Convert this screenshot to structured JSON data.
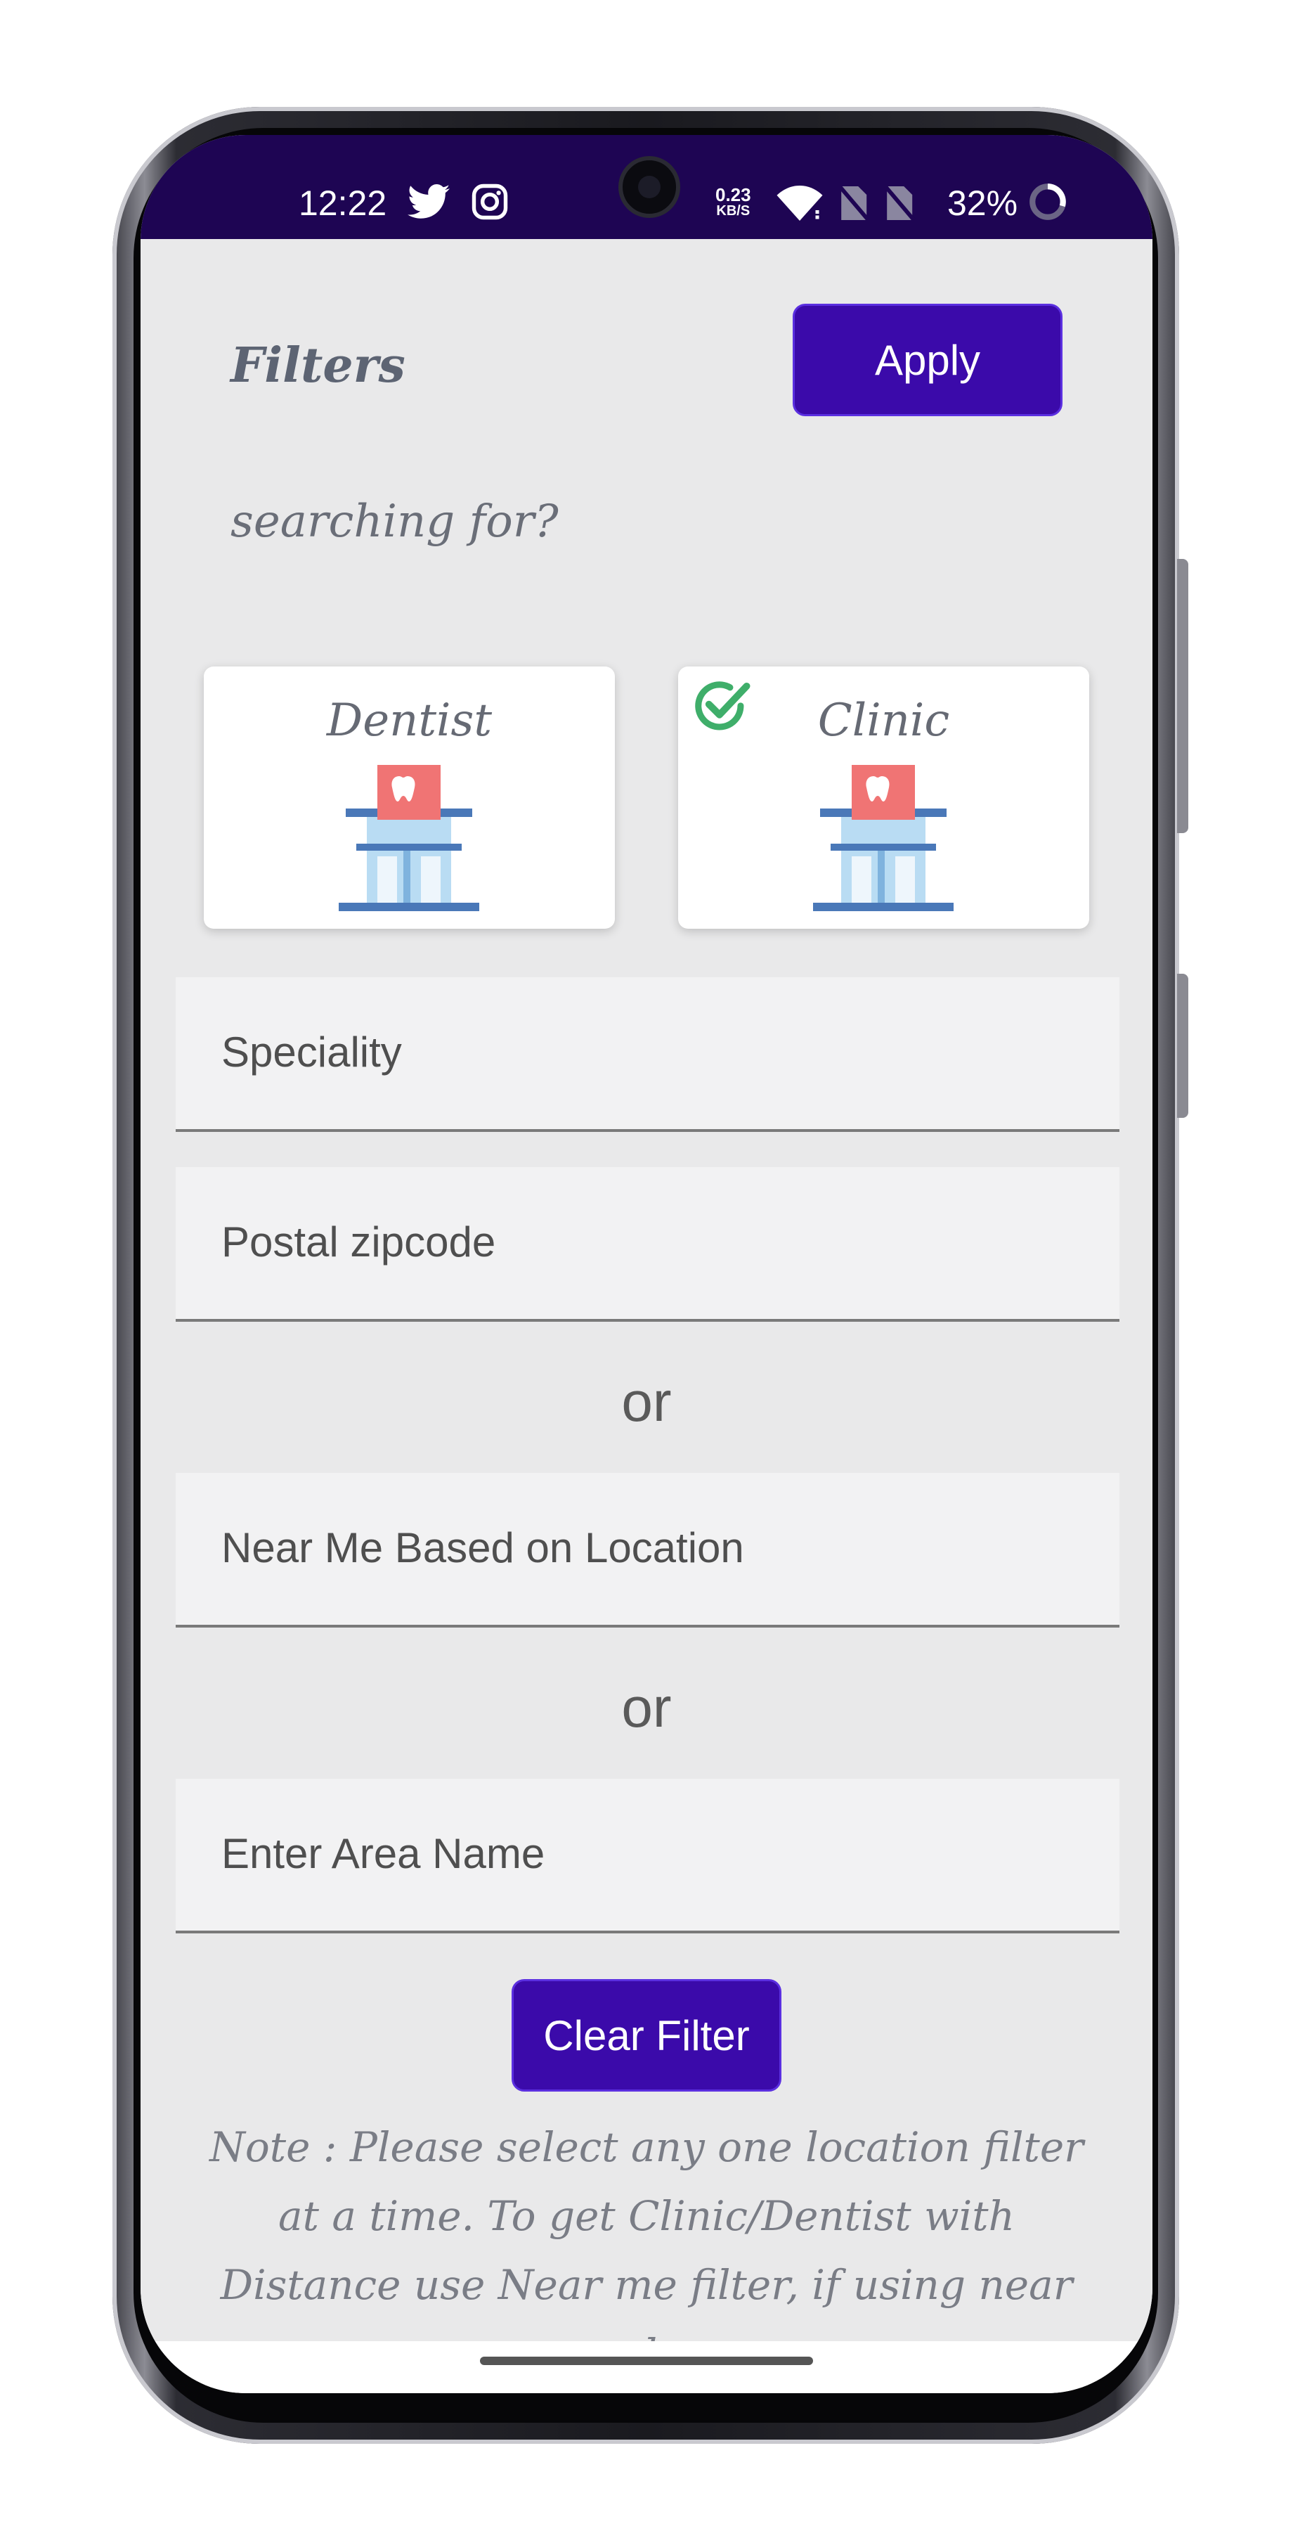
{
  "status_bar": {
    "time": "12:22",
    "speed_value": "0.23",
    "speed_unit": "KB/S",
    "battery": "32%",
    "icons": [
      "twitter-icon",
      "instagram-icon",
      "wifi-icon",
      "no-sim-icon",
      "no-sim-icon",
      "battery-ring-icon"
    ]
  },
  "header": {
    "title": "Filters",
    "apply_label": "Apply"
  },
  "search_prompt": "searching for?",
  "categories": [
    {
      "label": "Dentist",
      "selected": false,
      "icon": "dental-clinic-building-icon"
    },
    {
      "label": "Clinic",
      "selected": true,
      "icon": "dental-clinic-building-icon"
    }
  ],
  "fields": {
    "speciality": "Speciality",
    "postal": "Postal zipcode",
    "near_me": "Near Me Based on Location",
    "area": "Enter Area Name"
  },
  "or_text": "or",
  "clear_label": "Clear Filter",
  "note": "Note : Please select any one location filter at a time. To get Clinic/Dentist with Distance use Near me filter, if using near me please",
  "colors": {
    "primary": "#3b0aaa",
    "status_bar": "#1e0553",
    "background": "#e9e9ea",
    "check": "#3fae6a"
  }
}
